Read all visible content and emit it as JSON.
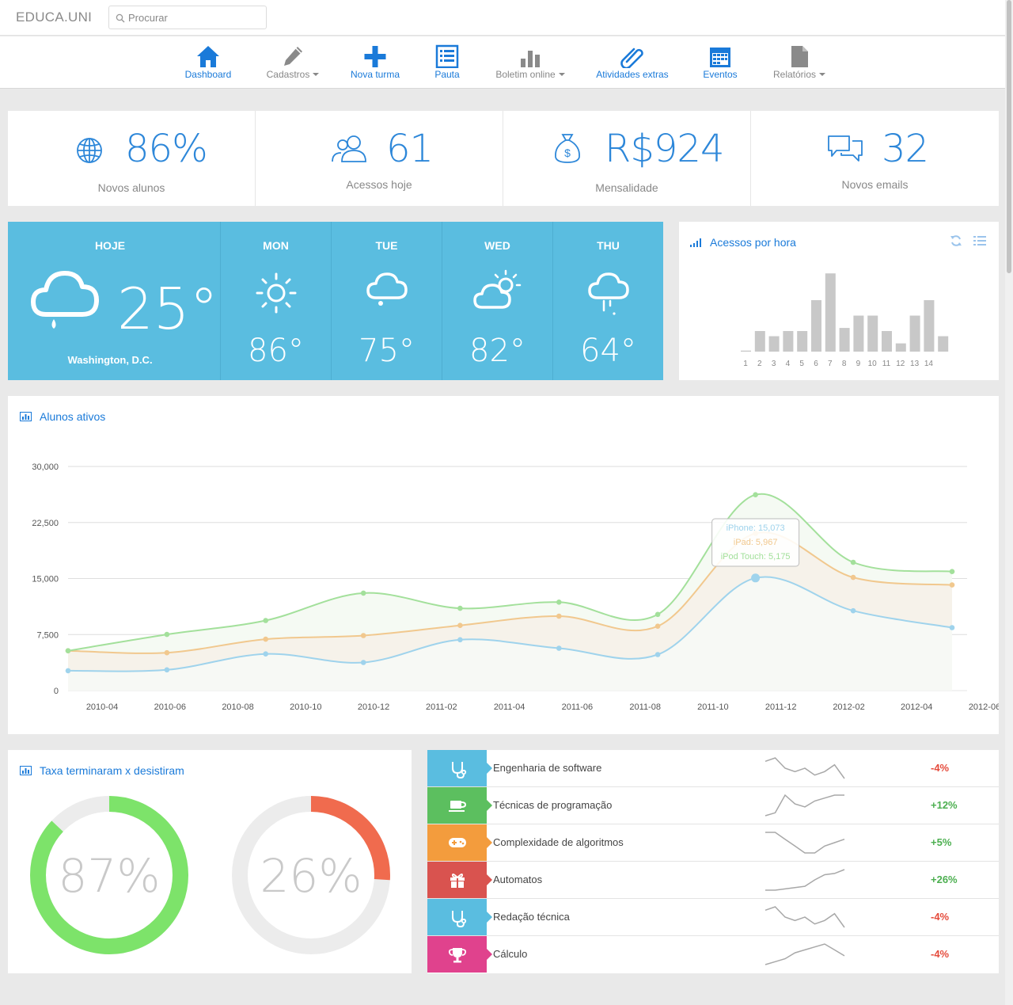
{
  "brand": "EDUCA.UNI",
  "search": {
    "placeholder": "Procurar"
  },
  "nav": [
    {
      "label": "Dashboard",
      "icon": "home-icon"
    },
    {
      "label": "Cadastros",
      "icon": "pencil-icon"
    },
    {
      "label": "Nova turma",
      "icon": "plus-icon"
    },
    {
      "label": "Pauta",
      "icon": "list-icon"
    },
    {
      "label": "Boletim online",
      "icon": "bar-chart-icon"
    },
    {
      "label": "Atividades extras",
      "icon": "paperclip-icon"
    },
    {
      "label": "Eventos",
      "icon": "calendar-icon"
    },
    {
      "label": "Relatórios",
      "icon": "document-icon"
    }
  ],
  "stats": [
    {
      "value": "86%",
      "caption": "Novos alunos",
      "icon": "globe-icon"
    },
    {
      "value": "61",
      "caption": "Acessos hoje",
      "icon": "users-icon"
    },
    {
      "value": "R$924",
      "caption": "Mensalidade",
      "icon": "money-bag-icon"
    },
    {
      "value": "32",
      "caption": "Novos emails",
      "icon": "chat-icon"
    }
  ],
  "weather": {
    "today": {
      "label": "HOJE",
      "temp": "25°",
      "city": "Washington, D.C.",
      "icon": "rain-cloud-icon"
    },
    "days": [
      {
        "label": "MON",
        "temp": "86°",
        "icon": "sun-icon"
      },
      {
        "label": "TUE",
        "temp": "75°",
        "icon": "cloud-icon"
      },
      {
        "label": "WED",
        "temp": "82°",
        "icon": "partly-cloudy-icon"
      },
      {
        "label": "THU",
        "temp": "64°",
        "icon": "drizzle-icon"
      }
    ]
  },
  "access": {
    "title": "Acessos por hora",
    "categories": [
      "1",
      "2",
      "3",
      "4",
      "5",
      "6",
      "7",
      "8",
      "9",
      "10",
      "11",
      "12",
      "13",
      "14"
    ],
    "values": [
      0.5,
      10,
      7.5,
      10,
      10,
      25,
      38,
      11.5,
      17.5,
      17.5,
      10,
      4,
      17.5,
      25,
      7.5
    ]
  },
  "line_panel": {
    "title": "Alunos ativos"
  },
  "chart_data": {
    "type": "area",
    "title": "Alunos ativos",
    "x": [
      "2010-03",
      "2010-06",
      "2010-09",
      "2010-12",
      "2011-03",
      "2011-06",
      "2011-09",
      "2011-12",
      "2012-03",
      "2012-06"
    ],
    "x_ticks": [
      "2010-04",
      "2010-06",
      "2010-08",
      "2010-10",
      "2010-12",
      "2011-02",
      "2011-04",
      "2011-06",
      "2011-08",
      "2011-10",
      "2011-12",
      "2012-02",
      "2012-04",
      "2012-06"
    ],
    "y_ticks": [
      "0",
      "7,500",
      "15,000",
      "22,500",
      "30,000"
    ],
    "ylim": [
      0,
      30000
    ],
    "grid": true,
    "series": [
      {
        "name": "iPhone",
        "color": "#9fd3ec",
        "values": [
          2666,
          2778,
          4912,
          3767,
          6810,
          5670,
          4820,
          15073,
          10687,
          8432
        ]
      },
      {
        "name": "iPad",
        "color": "#f1c88e",
        "values": [
          2666,
          2294,
          1969,
          3597,
          1914,
          4293,
          3795,
          5967,
          4460,
          5713
        ]
      },
      {
        "name": "iPod Touch",
        "color": "#a3e09b",
        "values": [
          0,
          2441,
          2501,
          5689,
          2293,
          1881,
          1588,
          5175,
          2028,
          1791
        ]
      }
    ],
    "tooltip": {
      "lines": [
        "iPhone: 15,073",
        "iPad: 5,967",
        "iPod Touch: 5,175"
      ],
      "index": 7
    }
  },
  "donut_panel": {
    "title": "Taxa terminaram x desistiram",
    "donuts": [
      {
        "label": "87%",
        "value": 87,
        "color": "#7de36a"
      },
      {
        "label": "26%",
        "value": 26,
        "color": "#f06b4e"
      }
    ]
  },
  "courses": [
    {
      "name": "Engenharia de software",
      "pct": "-4%",
      "color": "#5abde0",
      "icon": "stethoscope-icon",
      "trend": "down",
      "spark": [
        8,
        9,
        6,
        5,
        6,
        4,
        5,
        7,
        3
      ]
    },
    {
      "name": "Técnicas de programação",
      "pct": "+12%",
      "color": "#5cbf5f",
      "icon": "coffee-icon",
      "trend": "up",
      "spark": [
        1,
        2,
        8,
        5,
        4,
        6,
        7,
        8,
        8
      ]
    },
    {
      "name": "Complexidade de algoritmos",
      "pct": "+5%",
      "color": "#f39c3d",
      "icon": "gamepad-icon",
      "trend": "up",
      "spark": [
        8,
        8,
        6,
        4,
        2,
        2,
        4,
        5,
        6
      ]
    },
    {
      "name": "Automatos",
      "pct": "+26%",
      "color": "#d9534f",
      "icon": "gift-icon",
      "trend": "up",
      "spark": [
        1,
        1,
        1.5,
        2,
        2.5,
        5,
        7,
        7.5,
        9
      ]
    },
    {
      "name": "Redação técnica",
      "pct": "-4%",
      "color": "#5abde0",
      "icon": "stethoscope-icon",
      "trend": "down",
      "spark": [
        8,
        9,
        6,
        5,
        6,
        4,
        5,
        7,
        3
      ]
    },
    {
      "name": "Cálculo",
      "pct": "-4%",
      "color": "#e0428d",
      "icon": "trophy-icon",
      "trend": "down",
      "spark": [
        1,
        2,
        3,
        5,
        6,
        7,
        8,
        6,
        4
      ]
    }
  ]
}
